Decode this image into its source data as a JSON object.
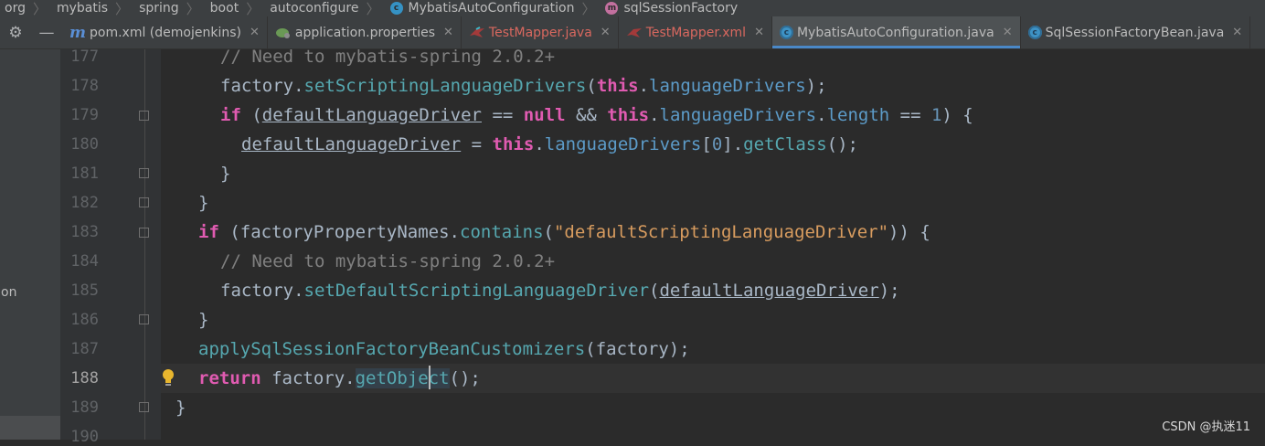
{
  "breadcrumb": [
    "org",
    "mybatis",
    "spring",
    "boot",
    "autoconfigure",
    "MybatisAutoConfiguration",
    "sqlSessionFactory"
  ],
  "toolbar": {
    "settings_icon": "gear-icon",
    "collapse_icon": "minus-icon"
  },
  "tabs": [
    {
      "label": "pom.xml (demojenkins)",
      "icon": "maven-icon"
    },
    {
      "label": "application.properties",
      "icon": "spring-leaf-icon"
    },
    {
      "label": "TestMapper.java",
      "icon": "mybatis-bird-icon"
    },
    {
      "label": "TestMapper.xml",
      "icon": "mybatis-bird-icon"
    },
    {
      "label": "MybatisAutoConfiguration.java",
      "icon": "class-icon",
      "active": true
    },
    {
      "label": "SqlSessionFactoryBean.java",
      "icon": "class-icon"
    }
  ],
  "tab_close_glyph": "✕",
  "sidebar": {
    "partial_text": "on"
  },
  "line_numbers": [
    "177",
    "178",
    "179",
    "180",
    "181",
    "182",
    "183",
    "184",
    "185",
    "186",
    "187",
    "188",
    "189",
    "190"
  ],
  "current_line": "188",
  "code": {
    "l177": "// Need to mybatis-spring 2.0.2+",
    "l178_a": "factory.",
    "l178_b": "setScriptingLanguageDrivers",
    "l178_c": "(",
    "l178_d": "this",
    "l178_e": ".",
    "l178_f": "languageDrivers",
    "l178_g": ");",
    "l179_a": "if",
    "l179_b": " (",
    "l179_c": "defaultLanguageDriver",
    "l179_d": " == ",
    "l179_e": "null",
    "l179_f": " && ",
    "l179_g": "this",
    "l179_h": ".",
    "l179_i": "languageDrivers",
    "l179_j": ".",
    "l179_k": "length",
    "l179_l": " == ",
    "l179_m": "1",
    "l179_n": ") {",
    "l180_a": "defaultLanguageDriver",
    "l180_b": " = ",
    "l180_c": "this",
    "l180_d": ".",
    "l180_e": "languageDrivers",
    "l180_f": "[",
    "l180_g": "0",
    "l180_h": "].",
    "l180_i": "getClass",
    "l180_j": "();",
    "l181": "}",
    "l182": "}",
    "l183_a": "if",
    "l183_b": " (factoryPropertyNames.",
    "l183_c": "contains",
    "l183_d": "(",
    "l183_e": "\"defaultScriptingLanguageDriver\"",
    "l183_f": ")) {",
    "l184": "// Need to mybatis-spring 2.0.2+",
    "l185_a": "factory.",
    "l185_b": "setDefaultScriptingLanguageDriver",
    "l185_c": "(",
    "l185_d": "defaultLanguageDriver",
    "l185_e": ");",
    "l186": "}",
    "l187_a": "applySqlSessionFactoryBeanCustomizers",
    "l187_b": "(factory);",
    "l188_a": "return",
    "l188_b": " factory.",
    "l188_c": "getObject",
    "l188_d": "();",
    "l189": "}"
  },
  "watermark": "CSDN @执迷11",
  "colors": {
    "background": "#2b2b2b",
    "keyword": "#cc7832",
    "this_keyword": "#e05bb1",
    "method": "#56a8b0",
    "comment": "#808080",
    "string": "#d89c5f",
    "active_tab_underline": "#4a88c7"
  }
}
